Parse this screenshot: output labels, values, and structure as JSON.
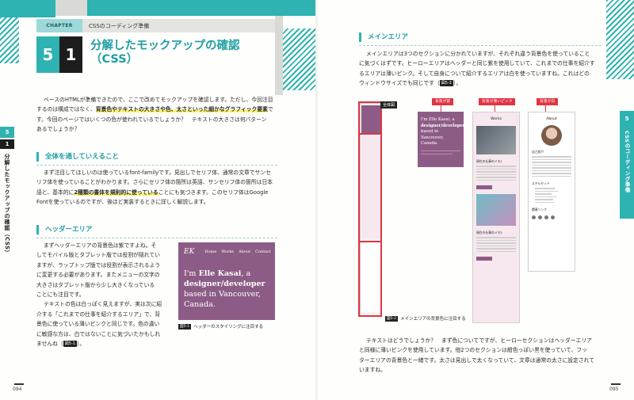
{
  "left_page": {
    "chapter_label": "CHAPTER",
    "chapter_title": "CSSのコーディング準備",
    "section_num_1": "5",
    "section_num_2": "1",
    "section_title_1": "分解したモックアップの確認",
    "section_title_2": "（CSS）",
    "side_tab_num": "5",
    "side_tab_sub": "1",
    "side_vertical": "分解したモックアップの確認（CSS）",
    "intro_lines": [
      "ベースのHTMLが準備できたので、ここで改めてモックアップを確認します。ただし、今回注目",
      "するのは構成ではなく、",
      "背景色やテキストの大きさや色、太さといった細かなグラフィック要素",
      "で",
      "す。今回のページではいくつの色が使われているでしょうか？　テキストの大きさは何パターン",
      "あるでしょうか？"
    ],
    "h_overall": "全体を通していえること",
    "overall_lines": [
      "まず注目してほしいのは使っているfont-familyです。見出しでセリフ体、通常の文章でサンセ",
      "リフ体を使っていることがわかります。さらにセリフ体の箇所は英語、サンセリフ体の箇所は日本",
      "語と、基本的に",
      "2種類の書体を規則的に使っている",
      "ことにも気づきます。このセリフ体はGoogle",
      "Fontを使っているのですが、後ほど実装するときに詳しく解説します。"
    ],
    "h_header": "ヘッダーエリア",
    "header_lines": [
      "まずヘッダーエリアの背景色は紫ですよね。そ",
      "してモバイル版とタブレット版では役割が隠れてい",
      "ますが、ラップトップ版では役割が表示されるよう",
      "に変更する必要があります。またメニューの文字の",
      "大きさはタブレット版から少し大きくなっている",
      "ことにも注目です。",
      "テキストの色は白っぽく見えますが、実は次に紹",
      "介する「これまでの仕事を紹介するエリア」で、背",
      "景色に使っている薄いピンクと同じです。色の違い",
      "に敏感な方は、白ではないことに気づいたかもしれ",
      "ませんね（",
      "図5-1",
      "）。"
    ],
    "mock_logo": "EK",
    "mock_nav": [
      "Home",
      "Works",
      "About",
      "Contact"
    ],
    "mock_hero_1": "I'm ",
    "mock_hero_name": "Elle Kasai",
    "mock_hero_2": ", a",
    "mock_hero_3": "designer/developer",
    "mock_hero_4": "based in Vancouver,",
    "mock_hero_5": "Canada.",
    "fig1_tag": "図5-1",
    "fig1_caption": "ヘッダーのスタイリングに注目する",
    "folio": "094"
  },
  "right_page": {
    "h_main": "メインエリア",
    "main_lines": [
      "メインエリアは3つのセクションに分かれていますが、それぞれ違う背景色を使っていること",
      "に気づくはずです。ヒーローエリアはヘッダーと同じ紫を使用していて、これまでの仕事を紹介す",
      "るエリアは薄いピンク。そして自身について紹介するエリアは白を使っていますね。これはどの",
      "ウィンドウサイズでも同じです（",
      "図5-2",
      "）。"
    ],
    "whole_label": "全体図",
    "callout_purple": "背景が紫",
    "callout_pink": "背景が薄いピンク",
    "callout_white": "背景が白",
    "thumb_hero_1": "I'm Elle Kasai, a",
    "thumb_hero_2": "designer/developer",
    "thumb_hero_3": "based in Vancouver,",
    "thumb_hero_4": "Canada.",
    "thumb_works": "Works",
    "thumb_about": "About",
    "thumb_work1": "現在の仕事のメモ1",
    "thumb_work2": "現在の仕事のメモ2",
    "thumb_intro": "自己紹介",
    "thumb_skills": "スキルセット",
    "thumb_links": "関連リンク",
    "fig2_tag": "図5-2",
    "fig2_caption": "メインエリアの背景色に注目する",
    "side_tab_num": "5",
    "side_vertical": "CSSのコーディング準備",
    "bottom_lines": [
      "テキストはどうでしょうか？　まず色についてですが、ヒーローセクションはヘッダーエリア",
      "と同様に薄いピンクを使用しています。他2つのセクションは紺色っぽい黒を使っていて、フッ",
      "ターエリアの背景色と一緒です。太さは見出しで太くなっていて、文章は通常の太さに設定されて",
      "いますね。"
    ],
    "folio": "095"
  },
  "colors": {
    "accent": "#2fb2b2",
    "purple": "#8d5c86",
    "highlight": "#fff36b",
    "callout_red": "#e03442"
  }
}
